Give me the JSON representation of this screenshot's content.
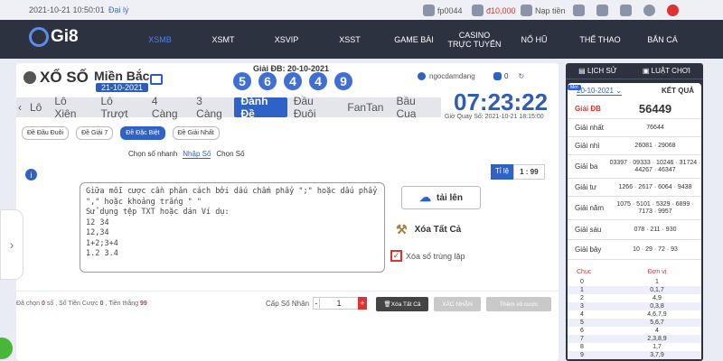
{
  "topbar": {
    "time": "2021-10-21 10:50:01",
    "agent": "Đại lý",
    "user": "fp0044",
    "balance": "đ10,000",
    "deposit": "Nạp tiền"
  },
  "nav": {
    "logo": "Gi8",
    "items": [
      "XSMB",
      "XSMT",
      "XSVIP",
      "XSST",
      "GAME BÀI",
      "CASINO TRỰC TUYẾN",
      "NỔ HŨ",
      "THỂ THAO",
      "BẮN CÁ"
    ]
  },
  "lottery": {
    "title": "XỔ SỐ",
    "region": "Miền Bắc",
    "date": "21-10-2021",
    "gdb_label": "Giải ĐB: 20-10-2021",
    "balls": [
      "5",
      "6",
      "4",
      "4",
      "9"
    ],
    "username": "ngocdamdang",
    "count": "0",
    "clock": "07:23:22",
    "next_draw": "Giờ Quay Số: 2021-10-21 18:15:00"
  },
  "tabs": [
    "Lô",
    "Lô Xiên",
    "Lô Trượt",
    "4 Càng",
    "3 Càng",
    "Đánh Đề",
    "Đầu Đuôi",
    "FanTan",
    "Bầu Cua"
  ],
  "subtabs": [
    "Đề Đầu Đuôi",
    "Đề Giải 7",
    "Đề Đặc Biệt",
    "Đề Giải Nhất"
  ],
  "modes": [
    "Chọn số nhanh",
    "Nhập Số",
    "Chọn Số"
  ],
  "ratio": {
    "label": "Tỉ lệ",
    "value": "1 : 99"
  },
  "textarea": "Giữa mỗi cược cần phân cách bởi dấu chấm phẩy \";\" hoặc dấu phẩy\n\",\" hoặc khoảng trắng \" \"\nSử dụng tệp TXT hoặc dán Ví dụ:\n12 34\n12,34\n1+2;3+4\n1.2 3.4",
  "actions": {
    "upload": "tải lên",
    "clear": "Xóa Tất Cả",
    "dup": "Xóa số trùng lặp"
  },
  "bottom": {
    "selected_pre": "Đã chọn",
    "selected": "0",
    "selected_post": "số , Số Tiền Cược",
    "bet": "0",
    "win_pre": ", Tiền thắng",
    "win": "99",
    "mult_label": "Cấp Số Nhân",
    "mult_value": "1",
    "btn_clear": "Xóa Tất Cả",
    "btn_confirm": "XÁC NHẬN",
    "btn_cart": "Thêm vô cược"
  },
  "results": {
    "history": "LỊCH SỬ",
    "rules": "LUẬT CHƠI",
    "badge": "Mới",
    "date": "20-10-2021",
    "title": "KẾT QUẢ",
    "prizes": [
      {
        "name": "Giải ĐB",
        "value": "56449"
      },
      {
        "name": "Giải nhất",
        "value": "76644"
      },
      {
        "name": "Giải nhì",
        "value": "26081 · 29068"
      },
      {
        "name": "Giải ba",
        "value": "03397 · 09333 · 10246 · 31724 · 44267 · 46347"
      },
      {
        "name": "Giải tư",
        "value": "1266 · 2617 · 6064 · 9438"
      },
      {
        "name": "Giải năm",
        "value": "1075 · 5101 · 5329 · 6899 · 7173 · 9957"
      },
      {
        "name": "Giải sáu",
        "value": "078 · 211 · 930"
      },
      {
        "name": "Giải bảy",
        "value": "10 · 29 · 72 · 93"
      }
    ],
    "chuc_label": "Chục",
    "donvi_label": "Đơn vị",
    "table": [
      [
        "0",
        "1"
      ],
      [
        "1",
        "0,1,7"
      ],
      [
        "2",
        "4,9"
      ],
      [
        "3",
        "0,3,8"
      ],
      [
        "4",
        "4,6,7,9"
      ],
      [
        "5",
        "5,6,7"
      ],
      [
        "6",
        "4"
      ],
      [
        "7",
        "2,3,8,9"
      ],
      [
        "8",
        "1,7"
      ],
      [
        "9",
        "3,7,9"
      ]
    ]
  },
  "colors": {
    "accent": "#2f62c6",
    "nav": "#2d3240",
    "red": "#d33"
  }
}
